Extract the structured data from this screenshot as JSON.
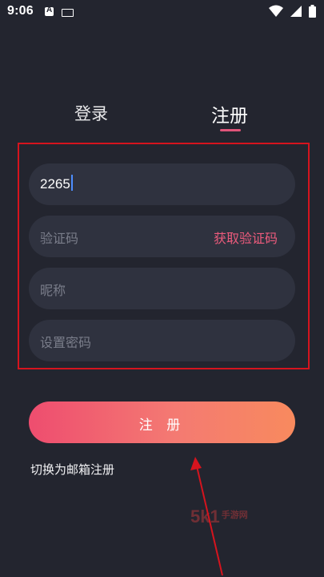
{
  "status_bar": {
    "time": "9:06"
  },
  "tabs": {
    "login": "登录",
    "register": "注册"
  },
  "form": {
    "phone_value": "2265",
    "code_placeholder": "验证码",
    "get_code_label": "获取验证码",
    "nickname_placeholder": "昵称",
    "password_placeholder": "设置密码"
  },
  "register_button": "注 册",
  "switch_email_label": "切换为邮箱注册",
  "watermark": {
    "main": "5k1",
    "sub": "手游网"
  },
  "colors": {
    "background": "#23252f",
    "field": "#2f323f",
    "accent": "#ec5b7c",
    "annotation_red": "#d5141e"
  }
}
